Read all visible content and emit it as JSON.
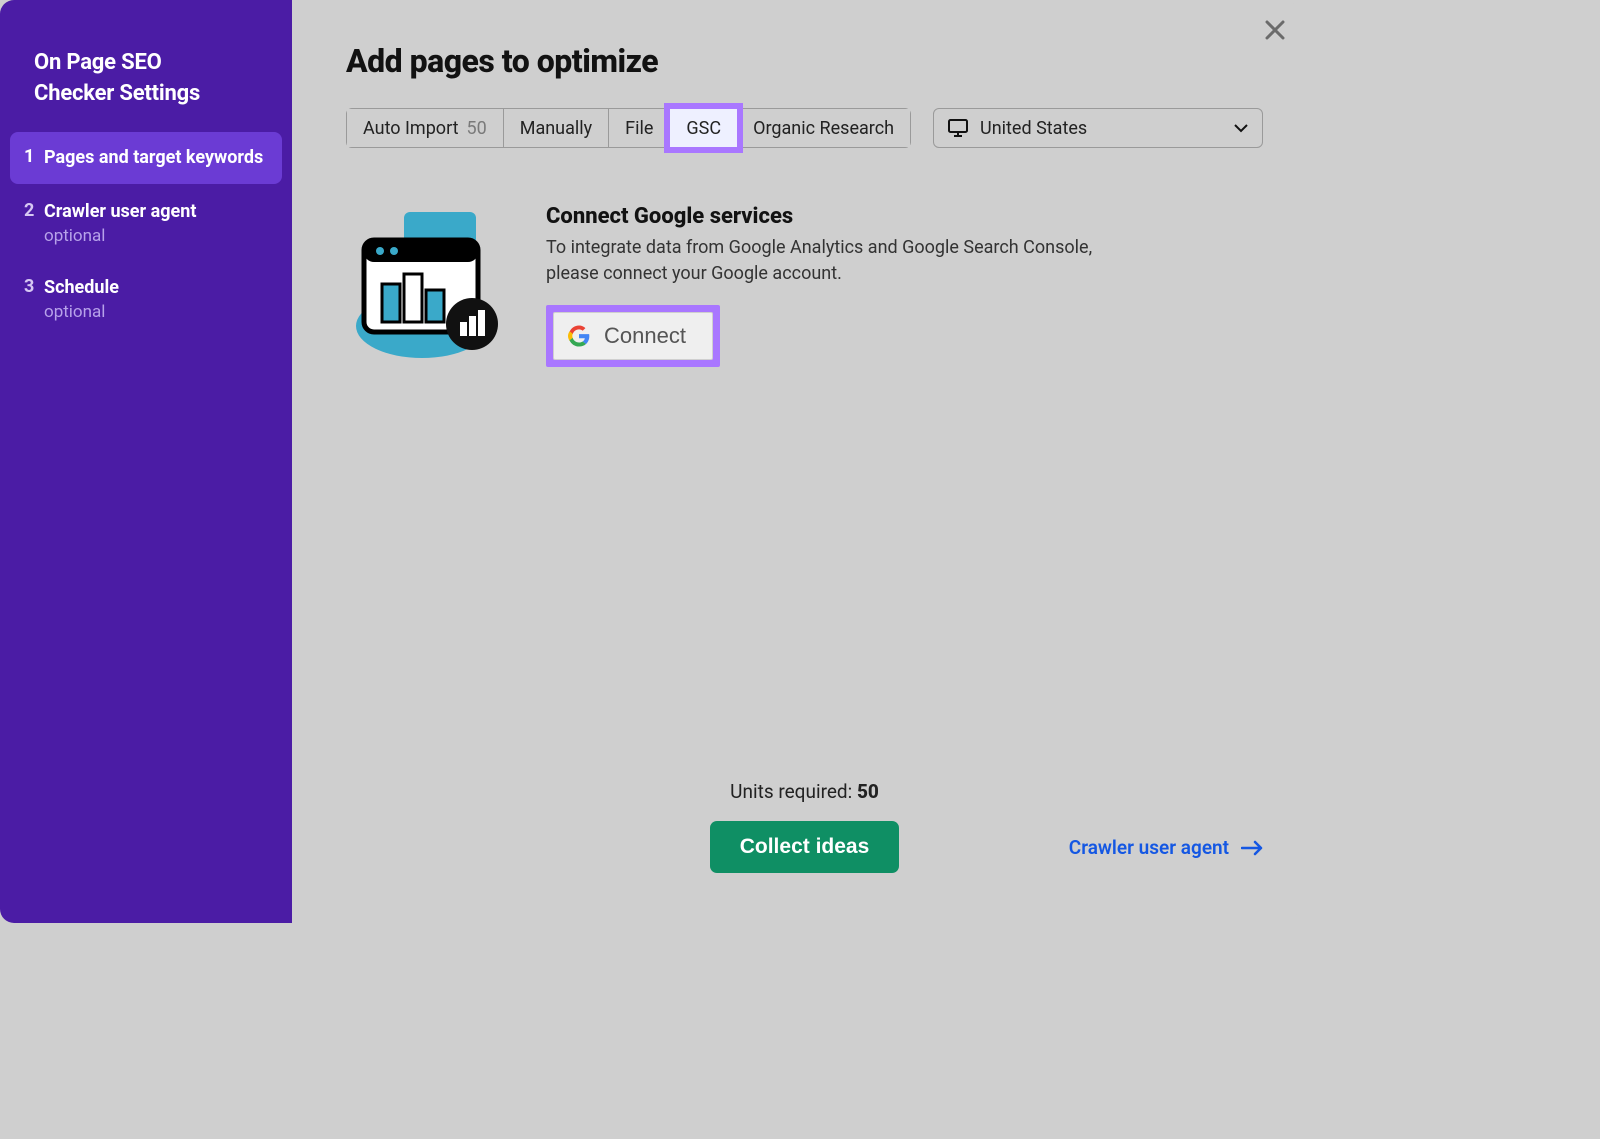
{
  "sidebar": {
    "title_line1": "On Page SEO",
    "title_line2": "Checker Settings",
    "steps": [
      {
        "num": "1",
        "label": "Pages and target keywords",
        "sub": "",
        "active": true
      },
      {
        "num": "2",
        "label": "Crawler user agent",
        "sub": "optional",
        "active": false
      },
      {
        "num": "3",
        "label": "Schedule",
        "sub": "optional",
        "active": false
      }
    ]
  },
  "main": {
    "title": "Add pages to optimize",
    "tabs": {
      "auto_import": "Auto Import",
      "auto_import_count": "50",
      "manually": "Manually",
      "file": "File",
      "gsc": "GSC",
      "organic": "Organic Research"
    },
    "country": {
      "label": "United States"
    },
    "connect": {
      "heading": "Connect Google services",
      "body": "To integrate data from Google Analytics and Google Search Console, please connect your Google account.",
      "button": "Connect"
    },
    "footer": {
      "units_label": "Units required: ",
      "units_value": "50",
      "collect": "Collect ideas",
      "next": "Crawler user agent"
    }
  }
}
